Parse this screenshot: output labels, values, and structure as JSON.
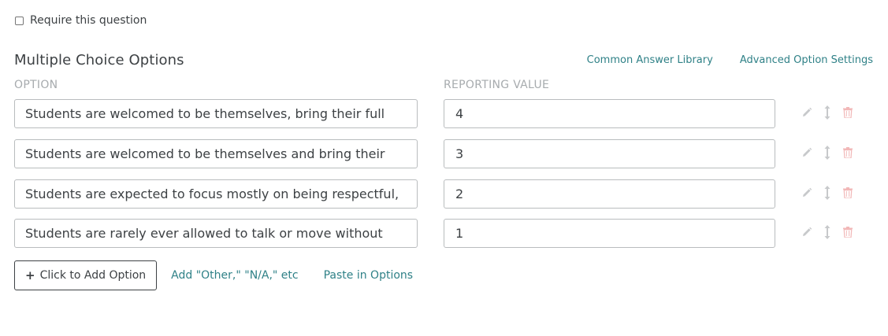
{
  "require": {
    "label": "Require this question",
    "checked": false
  },
  "section": {
    "title": "Multiple Choice Options",
    "links": [
      "Common Answer Library",
      "Advanced Option Settings"
    ]
  },
  "columns": {
    "option": "OPTION",
    "reporting_value": "REPORTING VALUE"
  },
  "options": [
    {
      "text": "Students are welcomed to be themselves, bring their full personalities AND families, cultures, and more, without off-limits",
      "value": "4"
    },
    {
      "text": "Students are welcomed to be themselves and bring their full personality and voices to the classroom",
      "value": "3"
    },
    {
      "text": "Students are expected to focus mostly on being respectful, following directions, being polite, learning, and contributing to class",
      "value": "2"
    },
    {
      "text": "Students are rarely ever allowed to talk or move without staff permission",
      "value": "1"
    }
  ],
  "row_icons": [
    "pencil-icon",
    "reorder-icon",
    "trash-icon"
  ],
  "actions": {
    "add_option": "Click to Add Option",
    "add_other": "Add \"Other,\" \"N/A,\" etc",
    "paste": "Paste in Options"
  },
  "colors": {
    "link": "#2f8187",
    "text": "#3d4144",
    "muted": "#a7abae",
    "trash": "#f2b8b8",
    "icon": "#c7c9cb"
  }
}
